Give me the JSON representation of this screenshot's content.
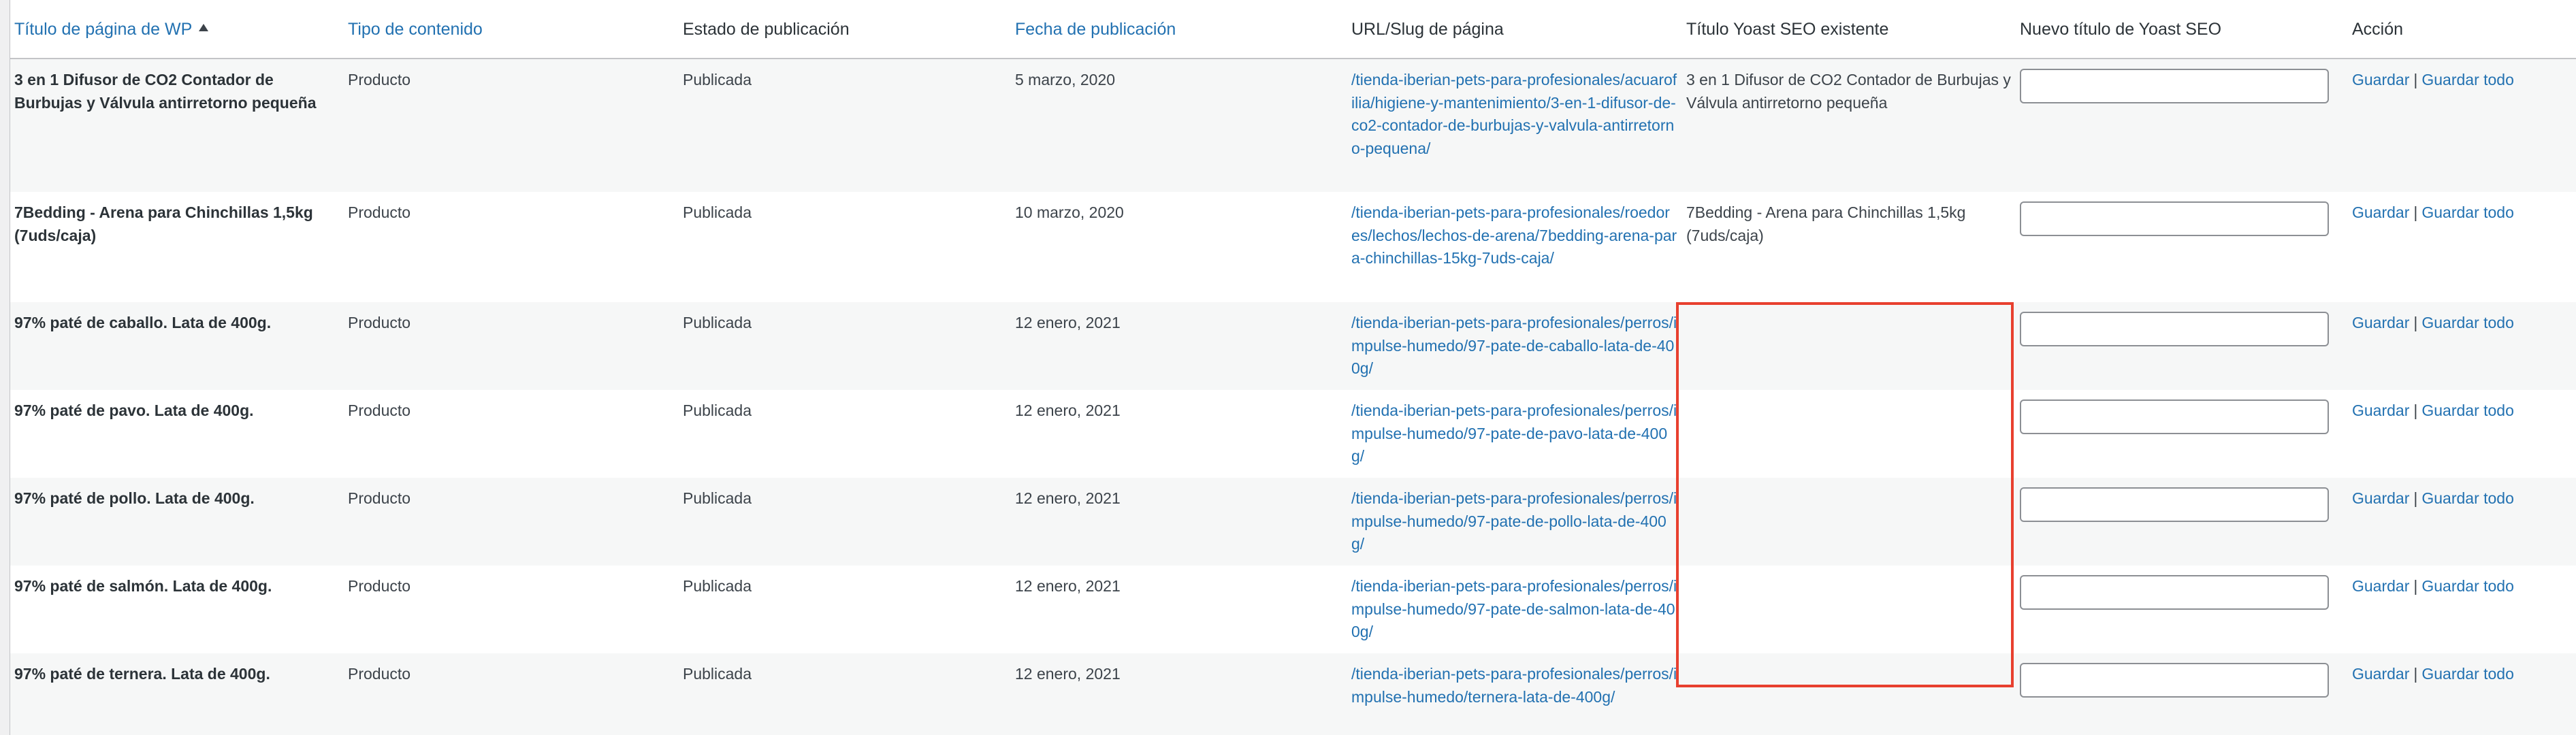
{
  "table": {
    "columns": [
      {
        "label": "Título de página de WP",
        "sortable": true,
        "sorted": "asc"
      },
      {
        "label": "Tipo de contenido",
        "sortable": true
      },
      {
        "label": "Estado de publicación",
        "sortable": false
      },
      {
        "label": "Fecha de publicación",
        "sortable": true
      },
      {
        "label": "URL/Slug de página",
        "sortable": false
      },
      {
        "label": "Título Yoast SEO existente",
        "sortable": false
      },
      {
        "label": "Nuevo título de Yoast SEO",
        "sortable": false
      },
      {
        "label": "Acción",
        "sortable": false
      }
    ],
    "rows": [
      {
        "title": "3 en 1 Difusor de CO2 Contador de Burbujas y Válvula antirretorno pequeña",
        "type": "Producto",
        "status": "Publicada",
        "date": "5 marzo, 2020",
        "slug": "/tienda-iberian-pets-para-profesionales/acuarofilia/higiene-y-mantenimiento/3-en-1-difusor-de-co2-contador-de-burbujas-y-valvula-antirretorno-pequena/",
        "yoast_title": "3 en 1 Difusor de CO2 Contador de Burbujas y Válvula antirretorno pequeña",
        "new_title": "",
        "save": "Guardar",
        "save_all": "Guardar todo"
      },
      {
        "title": "7Bedding - Arena para Chinchillas 1,5kg (7uds/caja)",
        "type": "Producto",
        "status": "Publicada",
        "date": "10 marzo, 2020",
        "slug": "/tienda-iberian-pets-para-profesionales/roedores/lechos/lechos-de-arena/7bedding-arena-para-chinchillas-15kg-7uds-caja/",
        "yoast_title": "7Bedding - Arena para Chinchillas 1,5kg (7uds/caja)",
        "new_title": "",
        "save": "Guardar",
        "save_all": "Guardar todo"
      },
      {
        "title": "97% paté de caballo. Lata de 400g.",
        "type": "Producto",
        "status": "Publicada",
        "date": "12 enero, 2021",
        "slug": "/tienda-iberian-pets-para-profesionales/perros/impulse-humedo/97-pate-de-caballo-lata-de-400g/",
        "yoast_title": "",
        "new_title": "",
        "save": "Guardar",
        "save_all": "Guardar todo"
      },
      {
        "title": "97% paté de pavo. Lata de 400g.",
        "type": "Producto",
        "status": "Publicada",
        "date": "12 enero, 2021",
        "slug": "/tienda-iberian-pets-para-profesionales/perros/impulse-humedo/97-pate-de-pavo-lata-de-400g/",
        "yoast_title": "",
        "new_title": "",
        "save": "Guardar",
        "save_all": "Guardar todo"
      },
      {
        "title": "97% paté de pollo. Lata de 400g.",
        "type": "Producto",
        "status": "Publicada",
        "date": "12 enero, 2021",
        "slug": "/tienda-iberian-pets-para-profesionales/perros/impulse-humedo/97-pate-de-pollo-lata-de-400g/",
        "yoast_title": "",
        "new_title": "",
        "save": "Guardar",
        "save_all": "Guardar todo"
      },
      {
        "title": "97% paté de salmón. Lata de 400g.",
        "type": "Producto",
        "status": "Publicada",
        "date": "12 enero, 2021",
        "slug": "/tienda-iberian-pets-para-profesionales/perros/impulse-humedo/97-pate-de-salmon-lata-de-400g/",
        "yoast_title": "",
        "new_title": "",
        "save": "Guardar",
        "save_all": "Guardar todo"
      },
      {
        "title": "97% paté de ternera. Lata de 400g.",
        "type": "Producto",
        "status": "Publicada",
        "date": "12 enero, 2021",
        "slug": "/tienda-iberian-pets-para-profesionales/perros/impulse-humedo/ternera-lata-de-400g/",
        "yoast_title": "",
        "new_title": "",
        "save": "Guardar",
        "save_all": "Guardar todo"
      }
    ]
  },
  "colors": {
    "link": "#2271b1",
    "highlight": "#e8402f",
    "row_alt": "#f6f7f7"
  }
}
